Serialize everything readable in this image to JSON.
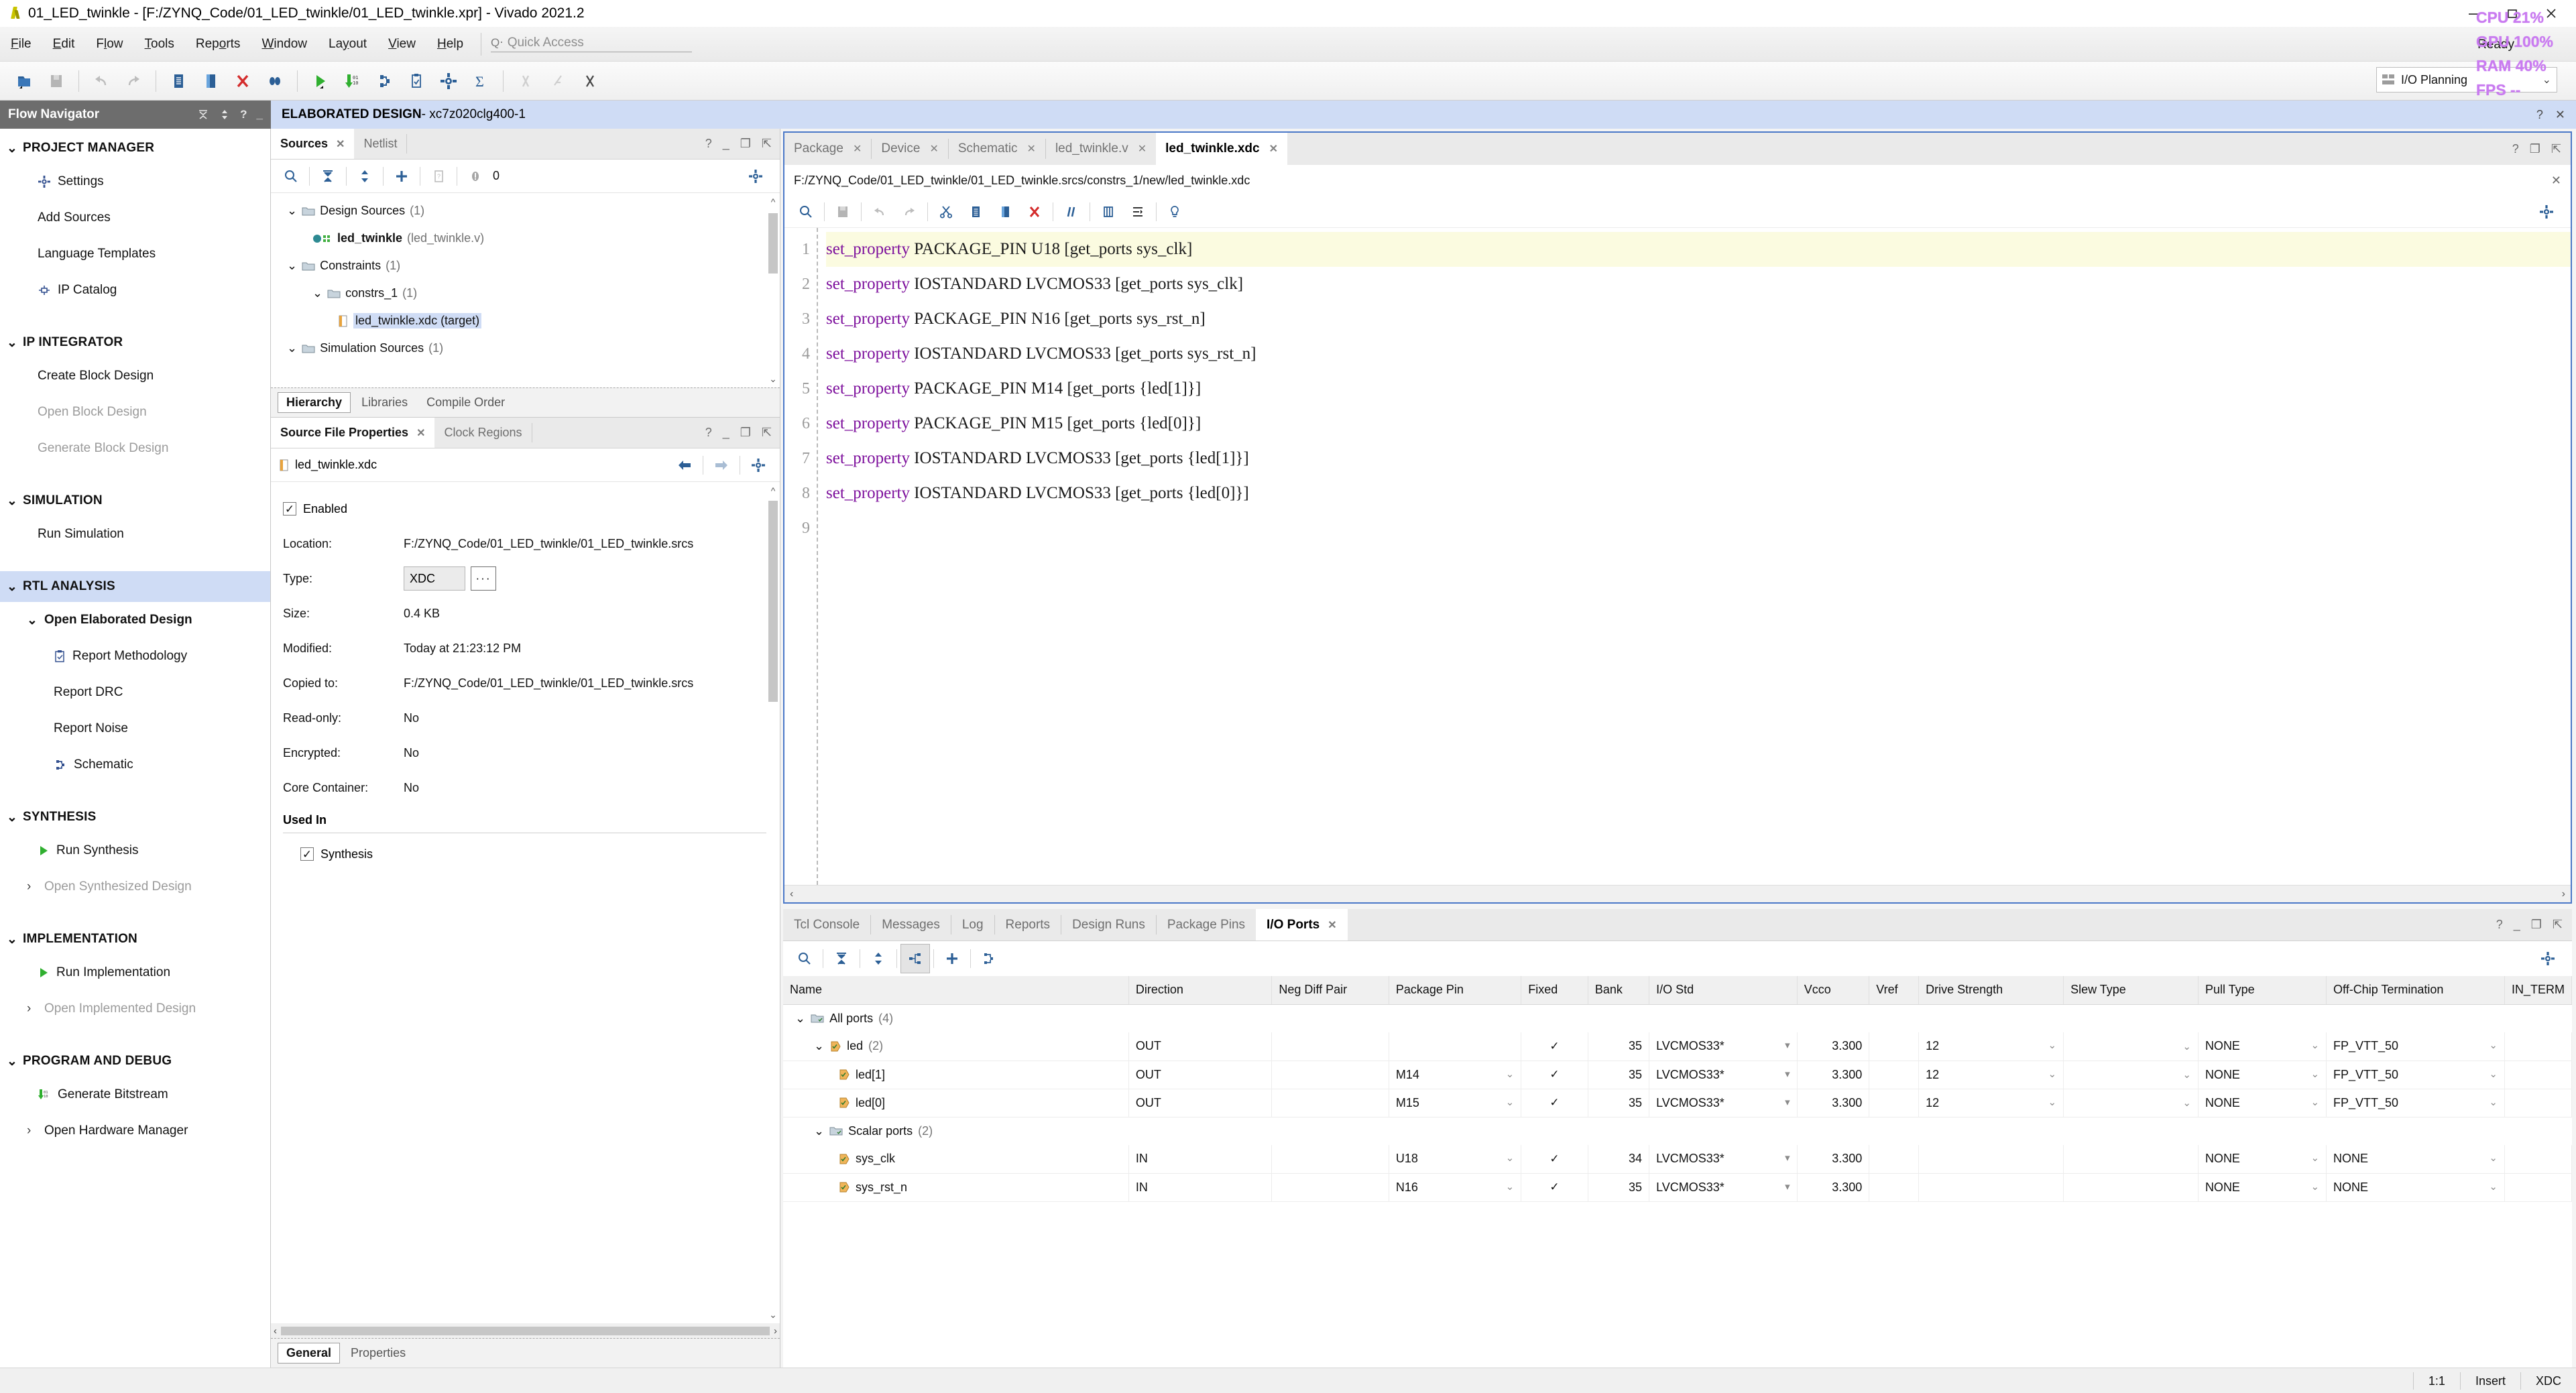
{
  "window": {
    "title": "01_LED_twinkle - [F:/ZYNQ_Code/01_LED_twinkle/01_LED_twinkle.xpr] - Vivado 2021.2",
    "minimize": "–",
    "restore": "❐",
    "close": "✕"
  },
  "menubar": {
    "items": [
      "File",
      "Edit",
      "Flow",
      "Tools",
      "Reports",
      "Window",
      "Layout",
      "View",
      "Help"
    ],
    "quick_access_placeholder": "Quick Access",
    "quick_access_value": ""
  },
  "toolbar": {
    "icons": [
      "open-project-icon",
      "save-icon",
      "undo-icon",
      "redo-icon",
      "add-sources-icon",
      "paste-icon",
      "delete-icon",
      "search-replace-icon",
      "run-icon",
      "generate-bitstream-icon",
      "schematic-icon",
      "report-methodology-icon",
      "settings-icon",
      "sum-icon",
      "marker-disabled-icon",
      "marker-cross-icon",
      "marker-x-icon"
    ],
    "layout_label": "I/O Planning",
    "layout_caret": "⌄"
  },
  "flow_navigator": {
    "title": "Flow Navigator",
    "header_icons": [
      "collapse-all-icon",
      "expand-collapse-icon",
      "help-icon",
      "minimize-icon"
    ],
    "groups": [
      {
        "label": "PROJECT MANAGER",
        "selected": false,
        "items": [
          {
            "label": "Settings",
            "icon": "gear-icon",
            "disabled": false,
            "bold": false,
            "indent": 0
          },
          {
            "label": "Add Sources",
            "icon": "",
            "disabled": false,
            "bold": false,
            "indent": 0
          },
          {
            "label": "Language Templates",
            "icon": "",
            "disabled": false,
            "bold": false,
            "indent": 0
          },
          {
            "label": "IP Catalog",
            "icon": "ip-catalog-icon",
            "disabled": false,
            "bold": false,
            "indent": 0
          }
        ]
      },
      {
        "label": "IP INTEGRATOR",
        "selected": false,
        "items": [
          {
            "label": "Create Block Design",
            "icon": "",
            "disabled": false,
            "bold": false,
            "indent": 0
          },
          {
            "label": "Open Block Design",
            "icon": "",
            "disabled": true,
            "bold": false,
            "indent": 0
          },
          {
            "label": "Generate Block Design",
            "icon": "",
            "disabled": true,
            "bold": false,
            "indent": 0
          }
        ]
      },
      {
        "label": "SIMULATION",
        "selected": false,
        "items": [
          {
            "label": "Run Simulation",
            "icon": "",
            "disabled": false,
            "bold": false,
            "indent": 0
          }
        ]
      },
      {
        "label": "RTL ANALYSIS",
        "selected": true,
        "items": [
          {
            "label": "Open Elaborated Design",
            "icon": "chevron-down-icon",
            "disabled": false,
            "bold": true,
            "indent": 0
          },
          {
            "label": "Report Methodology",
            "icon": "report-methodology-icon",
            "disabled": false,
            "bold": false,
            "indent": 1
          },
          {
            "label": "Report DRC",
            "icon": "",
            "disabled": false,
            "bold": false,
            "indent": 1
          },
          {
            "label": "Report Noise",
            "icon": "",
            "disabled": false,
            "bold": false,
            "indent": 1
          },
          {
            "label": "Schematic",
            "icon": "schematic-icon",
            "disabled": false,
            "bold": false,
            "indent": 1
          }
        ]
      },
      {
        "label": "SYNTHESIS",
        "selected": false,
        "items": [
          {
            "label": "Run Synthesis",
            "icon": "run-green-icon",
            "disabled": false,
            "bold": false,
            "indent": 0
          },
          {
            "label": "Open Synthesized Design",
            "icon": "chevron-right-icon",
            "disabled": true,
            "bold": false,
            "indent": 0
          }
        ]
      },
      {
        "label": "IMPLEMENTATION",
        "selected": false,
        "items": [
          {
            "label": "Run Implementation",
            "icon": "run-green-icon",
            "disabled": false,
            "bold": false,
            "indent": 0
          },
          {
            "label": "Open Implemented Design",
            "icon": "chevron-right-icon",
            "disabled": true,
            "bold": false,
            "indent": 0
          }
        ]
      },
      {
        "label": "PROGRAM AND DEBUG",
        "selected": false,
        "items": [
          {
            "label": "Generate Bitstream",
            "icon": "generate-bitstream-icon",
            "disabled": false,
            "bold": false,
            "indent": 0
          },
          {
            "label": "Open Hardware Manager",
            "icon": "chevron-right-icon",
            "disabled": false,
            "bold": false,
            "indent": 0
          }
        ]
      }
    ]
  },
  "design_bar": {
    "prefix": "ELABORATED DESIGN",
    "suffix": " - xc7z020clg400-1",
    "help": "?",
    "close": "✕"
  },
  "sources_panel": {
    "tabs": [
      {
        "label": "Sources",
        "active": true,
        "closable": true
      },
      {
        "label": "Netlist",
        "active": false,
        "closable": false
      }
    ],
    "toolbar_icons": [
      "search-icon",
      "collapse-all-icon",
      "expand-all-icon",
      "add-sources-icon",
      "report-icon",
      "message-count-icon",
      "gear-icon"
    ],
    "message_count": "0",
    "tree": [
      {
        "label": "Design Sources",
        "count": "(1)",
        "indent": 0,
        "icon": "folder-icon",
        "chevron": "⌄",
        "selected": false,
        "sub": ""
      },
      {
        "label": "led_twinkle",
        "count": "",
        "indent": 1,
        "icon": "module-icon",
        "chevron": "",
        "selected": false,
        "sub": "(led_twinkle.v)",
        "bold": true
      },
      {
        "label": "Constraints",
        "count": "(1)",
        "indent": 0,
        "icon": "folder-icon",
        "chevron": "⌄",
        "selected": false,
        "sub": ""
      },
      {
        "label": "constrs_1",
        "count": "(1)",
        "indent": 1,
        "icon": "folder-icon",
        "chevron": "⌄",
        "selected": false,
        "sub": ""
      },
      {
        "label": "led_twinkle.xdc (target)",
        "count": "",
        "indent": 2,
        "icon": "xdc-file-icon",
        "chevron": "",
        "selected": true,
        "sub": ""
      },
      {
        "label": "Simulation Sources",
        "count": "(1)",
        "indent": 0,
        "icon": "folder-icon",
        "chevron": "⌄",
        "selected": false,
        "sub": ""
      }
    ],
    "subtabs": [
      {
        "label": "Hierarchy",
        "active": true
      },
      {
        "label": "Libraries",
        "active": false
      },
      {
        "label": "Compile Order",
        "active": false
      }
    ]
  },
  "properties_panel": {
    "tabs": [
      {
        "label": "Source File Properties",
        "active": true,
        "closable": true
      },
      {
        "label": "Clock Regions",
        "active": false,
        "closable": false
      }
    ],
    "file_name": "led_twinkle.xdc",
    "nav_icons": [
      "back-arrow-icon",
      "forward-arrow-icon",
      "gear-icon"
    ],
    "enabled_label": "Enabled",
    "enabled_checked": true,
    "fields": [
      {
        "key": "Location:",
        "value": "F:/ZYNQ_Code/01_LED_twinkle/01_LED_twinkle.srcs"
      },
      {
        "key": "Type:",
        "value": "XDC",
        "kind": "select"
      },
      {
        "key": "Size:",
        "value": "0.4 KB"
      },
      {
        "key": "Modified:",
        "value": "Today at 21:23:12 PM"
      },
      {
        "key": "Copied to:",
        "value": "F:/ZYNQ_Code/01_LED_twinkle/01_LED_twinkle.srcs"
      },
      {
        "key": "Read-only:",
        "value": "No"
      },
      {
        "key": "Encrypted:",
        "value": "No"
      },
      {
        "key": "Core Container:",
        "value": "No"
      }
    ],
    "used_in_label": "Used In",
    "used_in": [
      {
        "label": "Synthesis",
        "checked": true
      }
    ],
    "subtabs": [
      {
        "label": "General",
        "active": true
      },
      {
        "label": "Properties",
        "active": false
      }
    ],
    "type_dots": "···"
  },
  "editor": {
    "tabs": [
      {
        "label": "Package",
        "active": false
      },
      {
        "label": "Device",
        "active": false
      },
      {
        "label": "Schematic",
        "active": false
      },
      {
        "label": "led_twinkle.v",
        "active": false
      },
      {
        "label": "led_twinkle.xdc",
        "active": true
      }
    ],
    "tab_close": "✕",
    "path": "F:/ZYNQ_Code/01_LED_twinkle/01_LED_twinkle.srcs/constrs_1/new/led_twinkle.xdc",
    "path_close": "✕",
    "toolbar_icons": [
      "search-icon",
      "save-icon",
      "undo-icon",
      "redo-icon",
      "cut-icon",
      "copy-icon",
      "paste-icon",
      "delete-icon",
      "comment-icon",
      "columns-icon",
      "indent-icon",
      "hint-icon"
    ],
    "lines": [
      {
        "n": "1",
        "kw": "set_property",
        "mid": " PACKAGE_PIN U18 ",
        "arg": "[get_ports sys_clk]",
        "highlight": true
      },
      {
        "n": "2",
        "kw": "set_property",
        "mid": " IOSTANDARD LVCMOS33 ",
        "arg": "[get_ports sys_clk]",
        "highlight": false
      },
      {
        "n": "3",
        "kw": "set_property",
        "mid": " PACKAGE_PIN N16 ",
        "arg": "[get_ports sys_rst_n]",
        "highlight": false
      },
      {
        "n": "4",
        "kw": "set_property",
        "mid": " IOSTANDARD LVCMOS33 ",
        "arg": "[get_ports sys_rst_n]",
        "highlight": false
      },
      {
        "n": "5",
        "kw": "set_property",
        "mid": " PACKAGE_PIN M14 ",
        "arg": "[get_ports {led[1]}]",
        "highlight": false
      },
      {
        "n": "6",
        "kw": "set_property",
        "mid": " PACKAGE_PIN M15 ",
        "arg": "[get_ports {led[0]}]",
        "highlight": false
      },
      {
        "n": "7",
        "kw": "set_property",
        "mid": " IOSTANDARD LVCMOS33 ",
        "arg": "[get_ports {led[1]}]",
        "highlight": false
      },
      {
        "n": "8",
        "kw": "set_property",
        "mid": " IOSTANDARD LVCMOS33 ",
        "arg": "[get_ports {led[0]}]",
        "highlight": false
      },
      {
        "n": "9",
        "kw": "",
        "mid": "",
        "arg": "",
        "highlight": false
      }
    ],
    "hscroll_left": "‹",
    "hscroll_right": "›"
  },
  "dock": {
    "tabs": [
      {
        "label": "Tcl Console",
        "active": false
      },
      {
        "label": "Messages",
        "active": false
      },
      {
        "label": "Log",
        "active": false
      },
      {
        "label": "Reports",
        "active": false
      },
      {
        "label": "Design Runs",
        "active": false
      },
      {
        "label": "Package Pins",
        "active": false
      },
      {
        "label": "I/O Ports",
        "active": true
      }
    ],
    "tab_close": "✕",
    "toolbar_icons": [
      "search-icon",
      "collapse-all-icon",
      "expand-all-icon",
      "group-icon",
      "add-icon",
      "schematic-icon"
    ],
    "gear": "gear-icon"
  },
  "io_ports": {
    "columns": [
      "Name",
      "Direction",
      "Neg Diff Pair",
      "Package Pin",
      "Fixed",
      "Bank",
      "I/O Std",
      "Vcco",
      "Vref",
      "Drive Strength",
      "Slew Type",
      "Pull Type",
      "Off-Chip Termination",
      "IN_TERM"
    ],
    "rows": [
      {
        "name": "All ports",
        "count": "(4)",
        "indent": 0,
        "chevron": "⌄",
        "icon": "folder-ports-icon",
        "direction": "",
        "neg_diff": "",
        "pin": "",
        "fixed": "",
        "bank": "",
        "iostd": "",
        "vcco": "",
        "vref": "",
        "drive": "",
        "slew": "",
        "pull": "",
        "offchip": "",
        "in_term": "",
        "group": true
      },
      {
        "name": "led",
        "count": "(2)",
        "indent": 1,
        "chevron": "⌄",
        "icon": "bus-port-icon",
        "direction": "OUT",
        "neg_diff": "",
        "pin": "",
        "fixed": "✓",
        "bank": "35",
        "iostd": "LVCMOS33*",
        "vcco": "3.300",
        "vref": "",
        "drive": "12",
        "slew": "",
        "pull": "NONE",
        "offchip": "FP_VTT_50",
        "in_term": "",
        "group": false
      },
      {
        "name": "led[1]",
        "count": "",
        "indent": 2,
        "chevron": "",
        "icon": "port-icon",
        "direction": "OUT",
        "neg_diff": "",
        "pin": "M14",
        "fixed": "✓",
        "bank": "35",
        "iostd": "LVCMOS33*",
        "vcco": "3.300",
        "vref": "",
        "drive": "12",
        "slew": "",
        "pull": "NONE",
        "offchip": "FP_VTT_50",
        "in_term": "",
        "group": false
      },
      {
        "name": "led[0]",
        "count": "",
        "indent": 2,
        "chevron": "",
        "icon": "port-icon",
        "direction": "OUT",
        "neg_diff": "",
        "pin": "M15",
        "fixed": "✓",
        "bank": "35",
        "iostd": "LVCMOS33*",
        "vcco": "3.300",
        "vref": "",
        "drive": "12",
        "slew": "",
        "pull": "NONE",
        "offchip": "FP_VTT_50",
        "in_term": "",
        "group": false
      },
      {
        "name": "Scalar ports",
        "count": "(2)",
        "indent": 1,
        "chevron": "⌄",
        "icon": "folder-ports-icon",
        "direction": "",
        "neg_diff": "",
        "pin": "",
        "fixed": "",
        "bank": "",
        "iostd": "",
        "vcco": "",
        "vref": "",
        "drive": "",
        "slew": "",
        "pull": "",
        "offchip": "",
        "in_term": "",
        "group": true
      },
      {
        "name": "sys_clk",
        "count": "",
        "indent": 2,
        "chevron": "",
        "icon": "in-port-icon",
        "direction": "IN",
        "neg_diff": "",
        "pin": "U18",
        "fixed": "✓",
        "bank": "34",
        "iostd": "LVCMOS33*",
        "vcco": "3.300",
        "vref": "",
        "drive": "",
        "slew": "",
        "pull": "NONE",
        "offchip": "NONE",
        "in_term": "",
        "group": false
      },
      {
        "name": "sys_rst_n",
        "count": "",
        "indent": 2,
        "chevron": "",
        "icon": "in-port-icon",
        "direction": "IN",
        "neg_diff": "",
        "pin": "N16",
        "fixed": "✓",
        "bank": "35",
        "iostd": "LVCMOS33*",
        "vcco": "3.300",
        "vref": "",
        "drive": "",
        "slew": "",
        "pull": "NONE",
        "offchip": "NONE",
        "in_term": "",
        "group": false
      }
    ]
  },
  "statusbar": {
    "zoom": "1:1",
    "mode": "Insert",
    "filetype": "XDC"
  },
  "overlay_stats": {
    "cpu": "CPU 21%",
    "gpu": "GPU 100%",
    "ram": "RAM 40%",
    "fps": "FPS --",
    "ready": "Ready"
  },
  "colors": {
    "accent_blue": "#4a78c8",
    "selection": "#cfdcf5",
    "keyword_purple": "#7d0f9c",
    "overlay_purple": "#c97bf0",
    "green_run": "#2faf2f",
    "red_delete": "#d42c2c"
  }
}
